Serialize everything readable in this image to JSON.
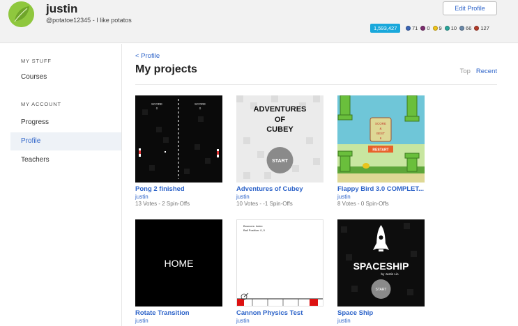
{
  "profile": {
    "name": "justin",
    "bio": "@potatoe12345 - I like potatos",
    "edit_label": "Edit Profile",
    "points": "1,593,427",
    "badges": [
      {
        "name": "blue-badge",
        "count": "71",
        "color": "#3a64b5"
      },
      {
        "name": "purple-badge",
        "count": "0",
        "color": "#7b2d6e"
      },
      {
        "name": "yellow-badge",
        "count": "9",
        "color": "#f0c419"
      },
      {
        "name": "teal-badge",
        "count": "10",
        "color": "#2aa59a"
      },
      {
        "name": "grey-badge",
        "count": "66",
        "color": "#6a88a8"
      },
      {
        "name": "red-badge",
        "count": "127",
        "color": "#b33c2a"
      }
    ]
  },
  "sidebar": {
    "my_stuff_heading": "MY STUFF",
    "courses": "Courses",
    "my_account_heading": "MY ACCOUNT",
    "progress": "Progress",
    "profile": "Profile",
    "teachers": "Teachers"
  },
  "main": {
    "back_link": "< Profile",
    "title": "My projects",
    "sort_top": "Top",
    "sort_recent": "Recent"
  },
  "projects": [
    {
      "title": "Pong 2 finished",
      "author": "justin",
      "stats": "13 Votes - 2 Spin-Offs",
      "score_left": "SCORE",
      "score_right": "SCORE",
      "score_left_val": "0",
      "score_right_val": "0"
    },
    {
      "title": "Adventures of Cubey",
      "author": "justin",
      "stats": "10 Votes - -1 Spin-Offs",
      "line1": "ADVENTURES",
      "line2": "OF",
      "line3": "CUBEY",
      "start": "START"
    },
    {
      "title": "Flappy Bird 3.0 COMPLET...",
      "author": "justin",
      "stats": "8 Votes - 0 Spin-Offs",
      "score_line1": "SCORE",
      "score_line2": "&",
      "score_line3": "BEST",
      "score_line4": "6",
      "restart": "RESTART"
    },
    {
      "title": "Rotate Transition",
      "author": "justin",
      "home": "HOME"
    },
    {
      "title": "Cannon Physics Test",
      "author": "justin",
      "readout1": "Bounces: Index",
      "readout2": "Ball Position: 0, 0"
    },
    {
      "title": "Space Ship",
      "author": "justin",
      "spaceship": "SPACESHIP",
      "byline": "by Justin Lin",
      "start": "START"
    }
  ]
}
